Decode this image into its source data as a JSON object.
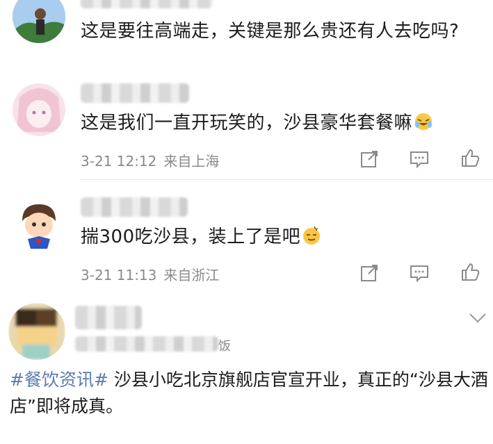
{
  "comments": [
    {
      "text": "这是要往高端走，关键是那么贵还有人去吃吗?",
      "time": "",
      "location": ""
    },
    {
      "text": "这是我们一直开玩笑的，沙县豪华套餐嘛",
      "time": "3-21 12:12",
      "location": "来自上海"
    },
    {
      "text": "揣300吃沙县，装上了是吧",
      "time": "3-21 11:13",
      "location": "来自浙江"
    }
  ],
  "post": {
    "username_suffix": "饭",
    "hashtag": "#餐饮资讯#",
    "text": "沙县小吃北京旗舰店官宣开业，真正的“沙县大酒店”即将成真。"
  },
  "icons": {
    "share": "share-icon",
    "comment": "comment-icon",
    "like": "thumbs-up-icon",
    "expand": "chevron-down-icon"
  },
  "colors": {
    "hashtag": "#5c7bb1",
    "meta": "#8a8a8a",
    "divider": "#e6e6e6"
  }
}
